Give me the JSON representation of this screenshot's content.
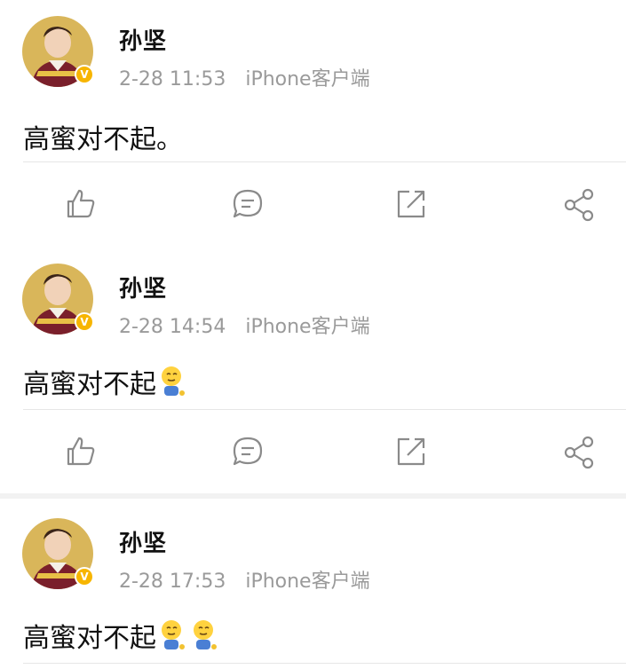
{
  "posts": [
    {
      "author": "孙坚",
      "time": "2-28 11:53",
      "source": "iPhone客户端",
      "text": "高蜜对不起。",
      "emoji_count": 0,
      "verified_badge": "V"
    },
    {
      "author": "孙坚",
      "time": "2-28 14:54",
      "source": "iPhone客户端",
      "text": "高蜜对不起",
      "emoji_count": 1,
      "verified_badge": "V"
    },
    {
      "author": "孙坚",
      "time": "2-28 17:53",
      "source": "iPhone客户端",
      "text": "高蜜对不起",
      "emoji_count": 2,
      "verified_badge": "V"
    }
  ],
  "actions": [
    "like-icon",
    "comment-icon",
    "repost-icon",
    "share-icon"
  ],
  "colors": {
    "meta_text": "#9a9a9a",
    "badge": "#f7b500",
    "icon_stroke": "#8a8a8a",
    "divider": "#e6e6e6"
  }
}
